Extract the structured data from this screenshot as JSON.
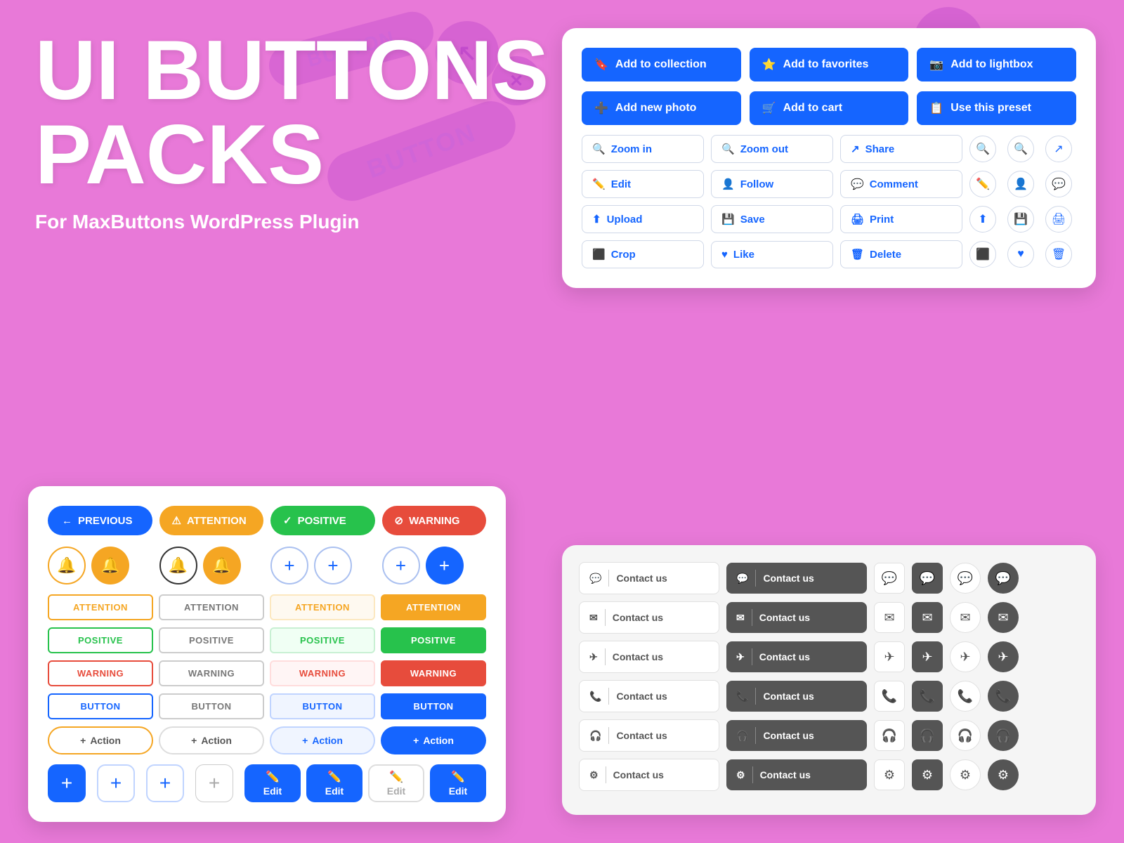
{
  "page": {
    "title_line1": "UI BUTTONS",
    "title_line2": "PACKS",
    "subtitle": "For MaxButtons WordPress Plugin",
    "bg_color": "#e879d8"
  },
  "top_right_panel": {
    "row1": [
      {
        "label": "Add to collection",
        "icon": "🔖"
      },
      {
        "label": "Add to favorites",
        "icon": "⭐"
      },
      {
        "label": "Add to lightbox",
        "icon": "📷"
      }
    ],
    "row2": [
      {
        "label": "Add new photo",
        "icon": "➕"
      },
      {
        "label": "Add to cart",
        "icon": "🛒"
      },
      {
        "label": "Use this preset",
        "icon": "📋"
      }
    ],
    "row3": [
      {
        "label": "Zoom in",
        "icon": "🔍"
      },
      {
        "label": "Zoom out",
        "icon": "🔍"
      },
      {
        "label": "Share",
        "icon": "↗"
      }
    ],
    "row4": [
      {
        "label": "Edit",
        "icon": "✏️"
      },
      {
        "label": "Follow",
        "icon": "👤"
      },
      {
        "label": "Comment",
        "icon": "💬"
      }
    ],
    "row5": [
      {
        "label": "Upload",
        "icon": "⬆"
      },
      {
        "label": "Save",
        "icon": "💾"
      },
      {
        "label": "Print",
        "icon": "🖨"
      }
    ],
    "row6": [
      {
        "label": "Crop",
        "icon": "⬜"
      },
      {
        "label": "Like",
        "icon": "♥"
      },
      {
        "label": "Delete",
        "icon": "🗑"
      }
    ]
  },
  "left_panel": {
    "top_buttons": [
      {
        "label": "PREVIOUS",
        "style": "prev"
      },
      {
        "label": "ATTENTION",
        "style": "attention"
      },
      {
        "label": "POSITIVE",
        "style": "positive"
      },
      {
        "label": "WARNING",
        "style": "warning"
      }
    ],
    "label_rows": {
      "attention": [
        "ATTENTION",
        "ATTENTION",
        "ATTENTION",
        "ATTENTION"
      ],
      "positive": [
        "POSITIVE",
        "POSITIVE",
        "POSITIVE",
        "POSITIVE"
      ],
      "warning": [
        "WARNING",
        "WARNING",
        "WARNING",
        "WARNING"
      ],
      "button": [
        "BUTTON",
        "BUTTON",
        "BUTTON",
        "BUTTON"
      ]
    },
    "action_labels": [
      "Action",
      "Action",
      "Action",
      "Action"
    ],
    "edit_labels": [
      "Edit",
      "Edit",
      "Edit",
      "Edit"
    ]
  },
  "bottom_right_panel": {
    "contact_label": "Contact us",
    "rows": [
      {
        "icon": "💬"
      },
      {
        "icon": "✉"
      },
      {
        "icon": "✈"
      },
      {
        "icon": "📞"
      },
      {
        "icon": "🎧"
      },
      {
        "icon": "⚙"
      }
    ]
  }
}
